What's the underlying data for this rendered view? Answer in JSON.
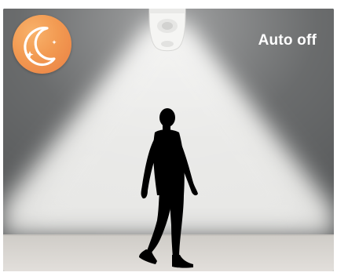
{
  "status": {
    "label": "Auto off"
  },
  "badge": {
    "icon": "crescent-moon-icon",
    "color": "#f29a52"
  },
  "colors": {
    "wall_dark": "#595b5c",
    "light_cone": "#e9e9e7",
    "floor": "#d6d3cf",
    "silhouette": "#000000"
  }
}
